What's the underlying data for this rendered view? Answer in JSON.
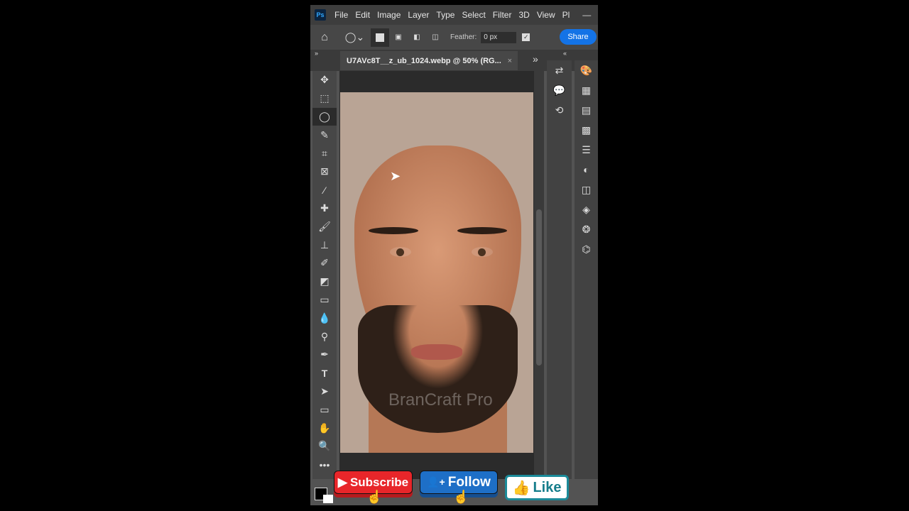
{
  "app": {
    "logo": "Ps",
    "menu": [
      "File",
      "Edit",
      "Image",
      "Layer",
      "Type",
      "Select",
      "Filter",
      "3D",
      "View",
      "Pl"
    ]
  },
  "options": {
    "feather_label": "Feather:",
    "feather_value": "0 px",
    "share_label": "Share",
    "anti_alias_checked": true
  },
  "document": {
    "tab_title": "U7AVc8T__z_ub_1024.webp @ 50% (RG...",
    "close": "×"
  },
  "watermark": "BranCraft Pro",
  "tools": [
    "move",
    "marquee",
    "lasso",
    "quick-select",
    "crop",
    "frame",
    "eyedropper",
    "healing",
    "brush",
    "stamp",
    "history-brush",
    "eraser",
    "gradient",
    "blur",
    "dodge",
    "pen",
    "type",
    "path-select",
    "rectangle",
    "hand",
    "zoom",
    "more"
  ],
  "overlay": {
    "subscribe": "Subscribe",
    "follow": "Follow",
    "like": "Like"
  },
  "colors": {
    "subscribe": "#e8262a",
    "follow": "#1e6fc7",
    "like": "#157d8b",
    "share": "#1473e6"
  }
}
